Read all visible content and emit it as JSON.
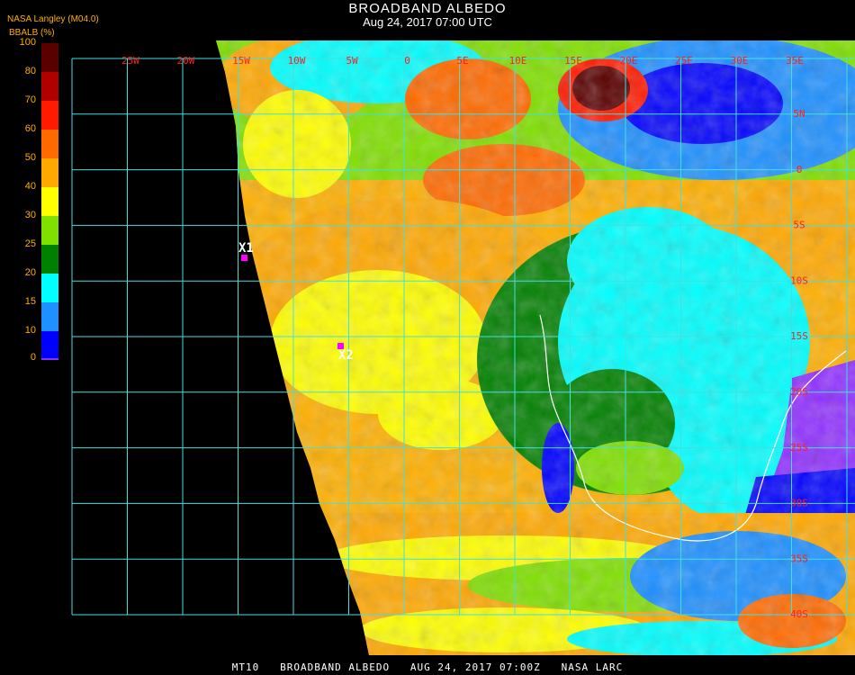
{
  "title": "BROADBAND ALBEDO",
  "subtitle": "Aug 24, 2017 07:00 UTC",
  "provider": "NASA Langley (M04.0)",
  "colorbar": {
    "label": "BBALB (%)",
    "ticks": [
      "100",
      "80",
      "70",
      "60",
      "50",
      "40",
      "30",
      "25",
      "20",
      "15",
      "10",
      "0"
    ],
    "colors": [
      "#5a0000",
      "#b00000",
      "#ff1a00",
      "#ff6a00",
      "#ffa800",
      "#ffff00",
      "#80e000",
      "#008000",
      "#00ffff",
      "#1e90ff",
      "#0000ff",
      "#9030ff"
    ]
  },
  "grid": {
    "lon_labels": [
      "25W",
      "20W",
      "15W",
      "10W",
      "5W",
      "0",
      "5E",
      "10E",
      "15E",
      "20E",
      "25E",
      "30E",
      "35E"
    ],
    "lat_labels": [
      "5N",
      "0",
      "5S",
      "10S",
      "15S",
      "20S",
      "25S",
      "30S",
      "35S",
      "40S"
    ]
  },
  "markers": [
    {
      "label": "X1",
      "color": "#ff00ff"
    },
    {
      "label": "X2",
      "color": "#ff00ff"
    }
  ],
  "footer": "MT10   BROADBAND ALBEDO   AUG 24, 2017 07:00Z   NASA LARC"
}
